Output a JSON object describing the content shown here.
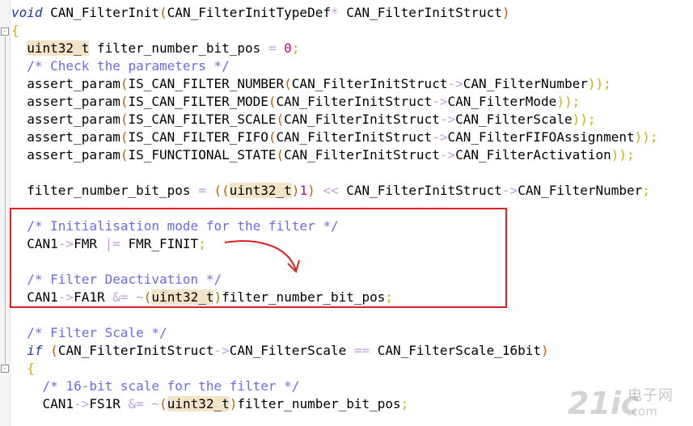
{
  "editor": {
    "fold": {
      "open": "-",
      "lines": ""
    },
    "lines": [
      [
        {
          "t": "void",
          "c": "kw"
        },
        {
          "t": " CAN_FilterInit"
        },
        {
          "t": "(",
          "c": "pa"
        },
        {
          "t": "CAN_FilterInitTypeDef"
        },
        {
          "t": "*",
          "c": "op"
        },
        {
          "t": " CAN_FilterInitStruct"
        },
        {
          "t": ")",
          "c": "pa"
        }
      ],
      [
        {
          "t": "{",
          "c": "pu"
        }
      ],
      [
        {
          "t": "  "
        },
        {
          "t": "uint32_t",
          "c": "ty"
        },
        {
          "t": " filter_number_bit_pos "
        },
        {
          "t": "=",
          "c": "op"
        },
        {
          "t": " "
        },
        {
          "t": "0",
          "c": "num"
        },
        {
          "t": ";",
          "c": "pu"
        }
      ],
      [
        {
          "t": "  "
        },
        {
          "t": "/* Check the parameters */",
          "c": "cm"
        }
      ],
      [
        {
          "t": "  assert_param"
        },
        {
          "t": "(",
          "c": "pa"
        },
        {
          "t": "IS_CAN_FILTER_NUMBER"
        },
        {
          "t": "(",
          "c": "pa"
        },
        {
          "t": "CAN_FilterInitStruct"
        },
        {
          "t": "->",
          "c": "op"
        },
        {
          "t": "CAN_FilterNumber"
        },
        {
          "t": "));",
          "c": "pu"
        }
      ],
      [
        {
          "t": "  assert_param"
        },
        {
          "t": "(",
          "c": "pa"
        },
        {
          "t": "IS_CAN_FILTER_MODE"
        },
        {
          "t": "(",
          "c": "pa"
        },
        {
          "t": "CAN_FilterInitStruct"
        },
        {
          "t": "->",
          "c": "op"
        },
        {
          "t": "CAN_FilterMode"
        },
        {
          "t": "));",
          "c": "pu"
        }
      ],
      [
        {
          "t": "  assert_param"
        },
        {
          "t": "(",
          "c": "pa"
        },
        {
          "t": "IS_CAN_FILTER_SCALE"
        },
        {
          "t": "(",
          "c": "pa"
        },
        {
          "t": "CAN_FilterInitStruct"
        },
        {
          "t": "->",
          "c": "op"
        },
        {
          "t": "CAN_FilterScale"
        },
        {
          "t": "));",
          "c": "pu"
        }
      ],
      [
        {
          "t": "  assert_param"
        },
        {
          "t": "(",
          "c": "pa"
        },
        {
          "t": "IS_CAN_FILTER_FIFO"
        },
        {
          "t": "(",
          "c": "pa"
        },
        {
          "t": "CAN_FilterInitStruct"
        },
        {
          "t": "->",
          "c": "op"
        },
        {
          "t": "CAN_FilterFIFOAssignment"
        },
        {
          "t": "));",
          "c": "pu"
        }
      ],
      [
        {
          "t": "  assert_param"
        },
        {
          "t": "(",
          "c": "pa"
        },
        {
          "t": "IS_FUNCTIONAL_STATE"
        },
        {
          "t": "(",
          "c": "pa"
        },
        {
          "t": "CAN_FilterInitStruct"
        },
        {
          "t": "->",
          "c": "op"
        },
        {
          "t": "CAN_FilterActivation"
        },
        {
          "t": "));",
          "c": "pu"
        }
      ],
      [],
      [
        {
          "t": "  filter_number_bit_pos "
        },
        {
          "t": "=",
          "c": "op"
        },
        {
          "t": " "
        },
        {
          "t": "((",
          "c": "pa"
        },
        {
          "t": "uint32_t",
          "c": "ty"
        },
        {
          "t": ")",
          "c": "pa"
        },
        {
          "t": "1",
          "c": "num"
        },
        {
          "t": ")",
          "c": "pa"
        },
        {
          "t": " "
        },
        {
          "t": "<<",
          "c": "op"
        },
        {
          "t": " CAN_FilterInitStruct"
        },
        {
          "t": "->",
          "c": "op"
        },
        {
          "t": "CAN_FilterNumber"
        },
        {
          "t": ";",
          "c": "pu"
        }
      ],
      [],
      [
        {
          "t": "  "
        },
        {
          "t": "/* Initialisation mode for the filter */",
          "c": "cm"
        }
      ],
      [
        {
          "t": "  CAN1"
        },
        {
          "t": "->",
          "c": "op"
        },
        {
          "t": "FMR "
        },
        {
          "t": "|=",
          "c": "op"
        },
        {
          "t": " FMR_FINIT"
        },
        {
          "t": ";",
          "c": "pu"
        }
      ],
      [],
      [
        {
          "t": "  "
        },
        {
          "t": "/* Filter Deactivation */",
          "c": "cm"
        }
      ],
      [
        {
          "t": "  CAN1"
        },
        {
          "t": "->",
          "c": "op"
        },
        {
          "t": "FA1R "
        },
        {
          "t": "&=",
          "c": "op"
        },
        {
          "t": " "
        },
        {
          "t": "~",
          "c": "op"
        },
        {
          "t": "(",
          "c": "pa"
        },
        {
          "t": "uint32_t",
          "c": "ty"
        },
        {
          "t": ")",
          "c": "pa"
        },
        {
          "t": "filter_number_bit_pos"
        },
        {
          "t": ";",
          "c": "pu"
        }
      ],
      [],
      [
        {
          "t": "  "
        },
        {
          "t": "/* Filter Scale */",
          "c": "cm"
        }
      ],
      [
        {
          "t": "  "
        },
        {
          "t": "if",
          "c": "kw"
        },
        {
          "t": " "
        },
        {
          "t": "(",
          "c": "pa"
        },
        {
          "t": "CAN_FilterInitStruct"
        },
        {
          "t": "->",
          "c": "op"
        },
        {
          "t": "CAN_FilterScale "
        },
        {
          "t": "==",
          "c": "op"
        },
        {
          "t": " CAN_FilterScale_16bit"
        },
        {
          "t": ")",
          "c": "pa"
        }
      ],
      [
        {
          "t": "  "
        },
        {
          "t": "{",
          "c": "pu"
        }
      ],
      [
        {
          "t": "    "
        },
        {
          "t": "/* 16-bit scale for the filter */",
          "c": "cm"
        }
      ],
      [
        {
          "t": "    CAN1"
        },
        {
          "t": "->",
          "c": "op"
        },
        {
          "t": "FS1R "
        },
        {
          "t": "&=",
          "c": "op"
        },
        {
          "t": " "
        },
        {
          "t": "~",
          "c": "op"
        },
        {
          "t": "(",
          "c": "pa"
        },
        {
          "t": "uint32_t",
          "c": "ty"
        },
        {
          "t": ")",
          "c": "pa"
        },
        {
          "t": "filter_number_bit_pos"
        },
        {
          "t": ";",
          "c": "pu"
        }
      ]
    ]
  },
  "watermark": {
    "main": "21ic",
    "cn": "电子网",
    "sub": ".com"
  },
  "colors": {
    "keyword": "#1a3aa0",
    "comment": "#6a6af0",
    "operator": "#c5a0e0",
    "number": "#d0007a",
    "punct": "#c8b010",
    "paren": "#c06000",
    "type_bg": "#f3e4c8",
    "highlight_box": "#e02020"
  }
}
